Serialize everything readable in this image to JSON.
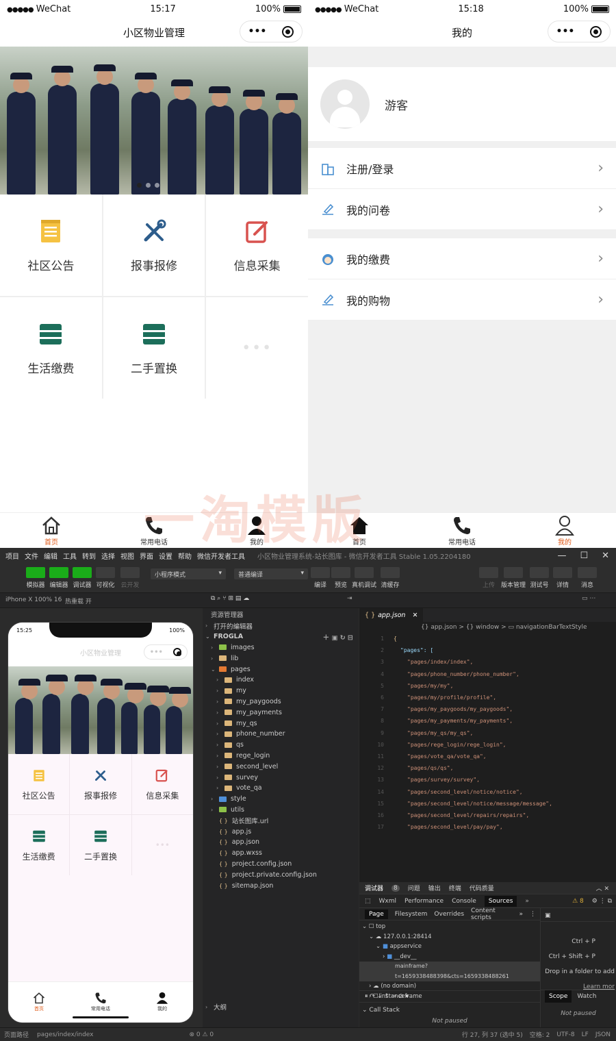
{
  "left_screen": {
    "status": {
      "carrier": "WeChat",
      "time": "15:17",
      "battery": "100%"
    },
    "title": "小区物业管理",
    "grid": [
      {
        "label": "社区公告",
        "icon": "notice-icon"
      },
      {
        "label": "报事报修",
        "icon": "tools-icon"
      },
      {
        "label": "信息采集",
        "icon": "edit-icon"
      },
      {
        "label": "生活缴费",
        "icon": "payment-icon"
      },
      {
        "label": "二手置换",
        "icon": "exchange-icon"
      }
    ],
    "tabs": [
      "首页",
      "常用电话",
      "我的"
    ]
  },
  "right_screen": {
    "status": {
      "carrier": "WeChat",
      "time": "15:18",
      "battery": "100%"
    },
    "title": "我的",
    "username": "游客",
    "menu1": [
      "注册/登录",
      "我的问卷"
    ],
    "menu2": [
      "我的缴费",
      "我的购物"
    ],
    "tabs": [
      "首页",
      "常用电话",
      "我的"
    ]
  },
  "watermark": "一淘模版",
  "ide": {
    "menus": [
      "项目",
      "文件",
      "编辑",
      "工具",
      "转到",
      "选择",
      "视图",
      "界面",
      "设置",
      "帮助",
      "微信开发者工具"
    ],
    "window_title": "小区物业管理系统-站长图库 - 微信开发者工具 Stable 1.05.2204180",
    "toolbar_left": [
      "模拟器",
      "编辑器",
      "调试器",
      "可视化",
      "云开发"
    ],
    "mode_select": "小程序模式",
    "compile_select": "普通编译",
    "toolbar_mid": [
      "编译",
      "预览",
      "真机调试",
      "清缓存"
    ],
    "toolbar_right": [
      "上传",
      "版本管理",
      "测试号",
      "详情",
      "消息"
    ],
    "device": "iPhone X 100% 16",
    "hotreload": "热重载 开",
    "sim": {
      "time": "15:25",
      "battery": "100%",
      "title": "小区物业管理",
      "grid": [
        "社区公告",
        "报事报修",
        "信息采集",
        "生活缴费",
        "二手置换"
      ],
      "tabs": [
        "首页",
        "常用电话",
        "我的"
      ]
    },
    "explorer": {
      "title": "资源管理器",
      "open_editors": "打开的编辑器",
      "project": "FROGLA",
      "tree": [
        {
          "name": "images",
          "indent": 1,
          "kind": "folder-green"
        },
        {
          "name": "lib",
          "indent": 1,
          "kind": "folder"
        },
        {
          "name": "pages",
          "indent": 1,
          "kind": "folder-orange"
        },
        {
          "name": "index",
          "indent": 2,
          "kind": "folder"
        },
        {
          "name": "my",
          "indent": 2,
          "kind": "folder"
        },
        {
          "name": "my_paygoods",
          "indent": 2,
          "kind": "folder"
        },
        {
          "name": "my_payments",
          "indent": 2,
          "kind": "folder"
        },
        {
          "name": "my_qs",
          "indent": 2,
          "kind": "folder"
        },
        {
          "name": "phone_number",
          "indent": 2,
          "kind": "folder"
        },
        {
          "name": "qs",
          "indent": 2,
          "kind": "folder"
        },
        {
          "name": "rege_login",
          "indent": 2,
          "kind": "folder"
        },
        {
          "name": "second_level",
          "indent": 2,
          "kind": "folder"
        },
        {
          "name": "survey",
          "indent": 2,
          "kind": "folder"
        },
        {
          "name": "vote_qa",
          "indent": 2,
          "kind": "folder"
        },
        {
          "name": "style",
          "indent": 1,
          "kind": "folder-blue"
        },
        {
          "name": "utils",
          "indent": 1,
          "kind": "folder-green"
        },
        {
          "name": "站长图库.url",
          "indent": 1,
          "kind": "file"
        },
        {
          "name": "app.js",
          "indent": 1,
          "kind": "file"
        },
        {
          "name": "app.json",
          "indent": 1,
          "kind": "file"
        },
        {
          "name": "app.wxss",
          "indent": 1,
          "kind": "file"
        },
        {
          "name": "project.config.json",
          "indent": 1,
          "kind": "file"
        },
        {
          "name": "project.private.config.json",
          "indent": 1,
          "kind": "file"
        },
        {
          "name": "sitemap.json",
          "indent": 1,
          "kind": "file"
        }
      ],
      "outline": "大纲",
      "status": "⊗ 0 ⚠ 0"
    },
    "editor": {
      "tab": "app.json",
      "breadcrumb": "{} app.json > {} window > ▭ navigationBarTextStyle",
      "lines": [
        "{",
        "\"pages\": [",
        "\"pages/index/index\",",
        "\"pages/phone_number/phone_number\",",
        "\"pages/my/my\",",
        "\"pages/my/profile/profile\",",
        "\"pages/my_paygoods/my_paygoods\",",
        "\"pages/my_payments/my_payments\",",
        "\"pages/my_qs/my_qs\",",
        "\"pages/rege_login/rege_login\",",
        "\"pages/vote_qa/vote_qa\",",
        "\"pages/qs/qs\",",
        "\"pages/survey/survey\",",
        "\"pages/second_level/notice/notice\",",
        "\"pages/second_level/notice/message/message\",",
        "\"pages/second_level/repairs/repairs\",",
        "\"pages/second_level/pay/pay\","
      ]
    },
    "devtools": {
      "tabs": [
        "调试器",
        "8",
        "问题",
        "输出",
        "终端",
        "代码质量"
      ],
      "panels": [
        "Wxml",
        "Performance",
        "Console",
        "Sources"
      ],
      "warn": "⚠ 8",
      "subtabs": [
        "Page",
        "Filesystem",
        "Overrides",
        "Content scripts"
      ],
      "tree": [
        "top",
        "127.0.0.1:28414",
        "appservice",
        "__dev__",
        "mainframe?t=1659338488398&cts=1659338488261",
        "(no domain)",
        "instanceframe"
      ],
      "shortcuts": [
        "Ctrl + P",
        "Ctrl + Shift + P",
        "Drop in a folder to add",
        "Learn mor"
      ],
      "scope": "Scope",
      "watch": "Watch",
      "not_paused": "Not paused",
      "call_stack": "Call Stack",
      "not_paused2": "Not paused"
    },
    "statusbar": {
      "path_label": "页面路径",
      "path": "pages/index/index",
      "right": [
        "行 27, 列 37 (选中 5)",
        "空格: 2",
        "UTF-8",
        "LF",
        "JSON"
      ]
    }
  }
}
